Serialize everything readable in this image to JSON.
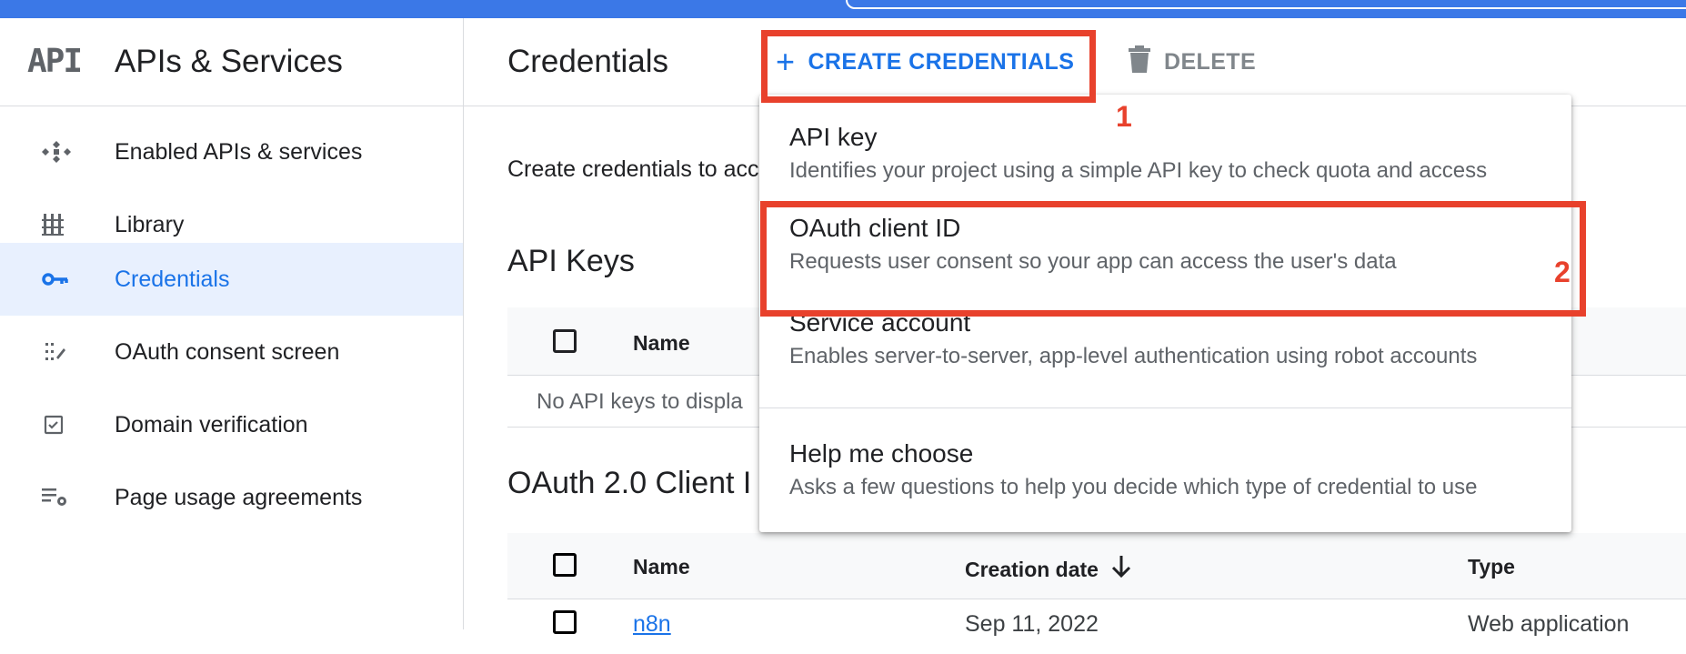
{
  "sidebar": {
    "logo_text": "API",
    "title": "APIs & Services",
    "items": [
      {
        "label": "Enabled APIs & services",
        "icon": "enabled-apis-icon"
      },
      {
        "label": "Library",
        "icon": "library-icon"
      },
      {
        "label": "Credentials",
        "icon": "key-icon",
        "active": true
      },
      {
        "label": "OAuth consent screen",
        "icon": "consent-screen-icon"
      },
      {
        "label": "Domain verification",
        "icon": "domain-verification-icon"
      },
      {
        "label": "Page usage agreements",
        "icon": "settings-list-icon"
      }
    ]
  },
  "header": {
    "title": "Credentials",
    "create_label": "CREATE CREDENTIALS",
    "delete_label": "DELETE"
  },
  "main": {
    "intro_text": "Create credentials to acc",
    "api_keys": {
      "title": "API Keys",
      "column_name": "Name",
      "empty_text": "No API keys to displa"
    },
    "oauth": {
      "title": "OAuth 2.0 Client I",
      "columns": [
        "Name",
        "Creation date",
        "Type"
      ],
      "rows": [
        {
          "name": "n8n",
          "date": "Sep 11, 2022",
          "type": "Web application"
        }
      ]
    }
  },
  "menu": {
    "items": [
      {
        "title": "API key",
        "desc": "Identifies your project using a simple API key to check quota and access"
      },
      {
        "title": "OAuth client ID",
        "desc": "Requests user consent so your app can access the user's data"
      },
      {
        "title": "Service account",
        "desc": "Enables server-to-server, app-level authentication using robot accounts"
      },
      {
        "title": "Help me choose",
        "desc": "Asks a few questions to help you decide which type of credential to use"
      }
    ]
  },
  "annotations": {
    "step1": "1",
    "step2": "2"
  },
  "colors": {
    "accent": "#1a73e8",
    "topbar": "#3b78e7",
    "annotation": "#e8412c",
    "active_bg": "#e8f0fe"
  }
}
